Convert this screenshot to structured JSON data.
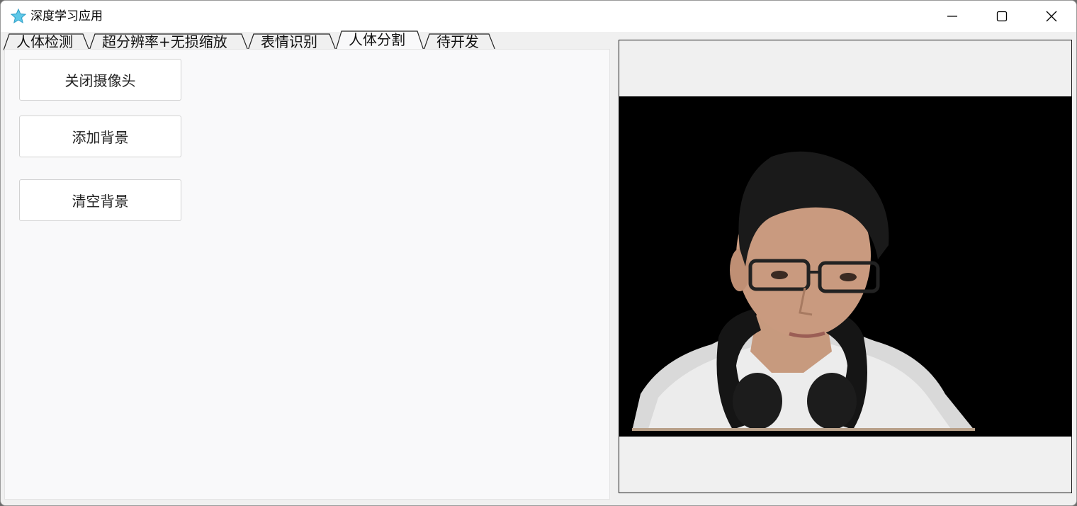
{
  "window": {
    "title": "深度学习应用",
    "icon": "star-app-icon"
  },
  "tabs": [
    {
      "label": "人体检测",
      "active": false
    },
    {
      "label": "超分辨率+无损缩放",
      "active": false
    },
    {
      "label": "表情识别",
      "active": false
    },
    {
      "label": "人体分割",
      "active": true
    },
    {
      "label": "待开发",
      "active": false
    }
  ],
  "buttons": {
    "close_camera": "关闭摄像头",
    "add_background": "添加背景",
    "clear_background": "清空背景"
  },
  "video": {
    "content": "segmented person on black background",
    "background_color": "#000000"
  },
  "colors": {
    "titlebar": "#ffffff",
    "client": "#f0f0f0",
    "panel": "#f9f9fa"
  }
}
